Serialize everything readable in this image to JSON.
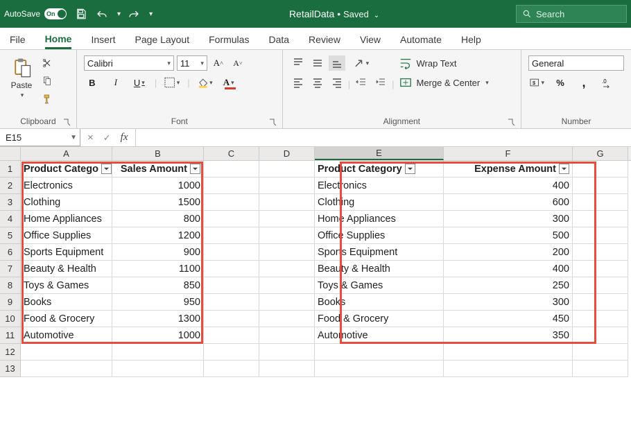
{
  "titlebar": {
    "autosave_label": "AutoSave",
    "toggle_text": "On",
    "file_name": "RetailData",
    "saved_text": "Saved"
  },
  "search": {
    "placeholder": "Search"
  },
  "menu": {
    "tabs": [
      "File",
      "Home",
      "Insert",
      "Page Layout",
      "Formulas",
      "Data",
      "Review",
      "View",
      "Automate",
      "Help"
    ],
    "active": "Home"
  },
  "ribbon": {
    "clipboard": {
      "paste": "Paste",
      "group_label": "Clipboard"
    },
    "font": {
      "name": "Calibri",
      "size": "11",
      "group_label": "Font"
    },
    "alignment": {
      "wrap": "Wrap Text",
      "merge": "Merge & Center",
      "group_label": "Alignment"
    },
    "number": {
      "format": "General",
      "group_label": "Number"
    }
  },
  "namebox": {
    "ref": "E15"
  },
  "columns": [
    "A",
    "B",
    "C",
    "D",
    "E",
    "F",
    "G"
  ],
  "selected_col": "E",
  "table1": {
    "hdr_category": "Product Catego",
    "hdr_value": "Sales Amount",
    "rows": [
      {
        "cat": "Electronics",
        "val": "1000"
      },
      {
        "cat": "Clothing",
        "val": "1500"
      },
      {
        "cat": "Home Appliances",
        "val": "800"
      },
      {
        "cat": "Office Supplies",
        "val": "1200"
      },
      {
        "cat": "Sports Equipment",
        "val": "900"
      },
      {
        "cat": "Beauty & Health",
        "val": "1100"
      },
      {
        "cat": "Toys & Games",
        "val": "850"
      },
      {
        "cat": "Books",
        "val": "950"
      },
      {
        "cat": "Food & Grocery",
        "val": "1300"
      },
      {
        "cat": "Automotive",
        "val": "1000"
      }
    ]
  },
  "table2": {
    "hdr_category": "Product Category",
    "hdr_value": "Expense Amount",
    "rows": [
      {
        "cat": "Electronics",
        "val": "400"
      },
      {
        "cat": "Clothing",
        "val": "600"
      },
      {
        "cat": "Home Appliances",
        "val": "300"
      },
      {
        "cat": "Office Supplies",
        "val": "500"
      },
      {
        "cat": "Sports Equipment",
        "val": "200"
      },
      {
        "cat": "Beauty & Health",
        "val": "400"
      },
      {
        "cat": "Toys & Games",
        "val": "250"
      },
      {
        "cat": "Books",
        "val": "300"
      },
      {
        "cat": "Food & Grocery",
        "val": "450"
      },
      {
        "cat": "Automotive",
        "val": "350"
      }
    ]
  },
  "row_numbers": [
    "1",
    "2",
    "3",
    "4",
    "5",
    "6",
    "7",
    "8",
    "9",
    "10",
    "11",
    "12",
    "13"
  ]
}
